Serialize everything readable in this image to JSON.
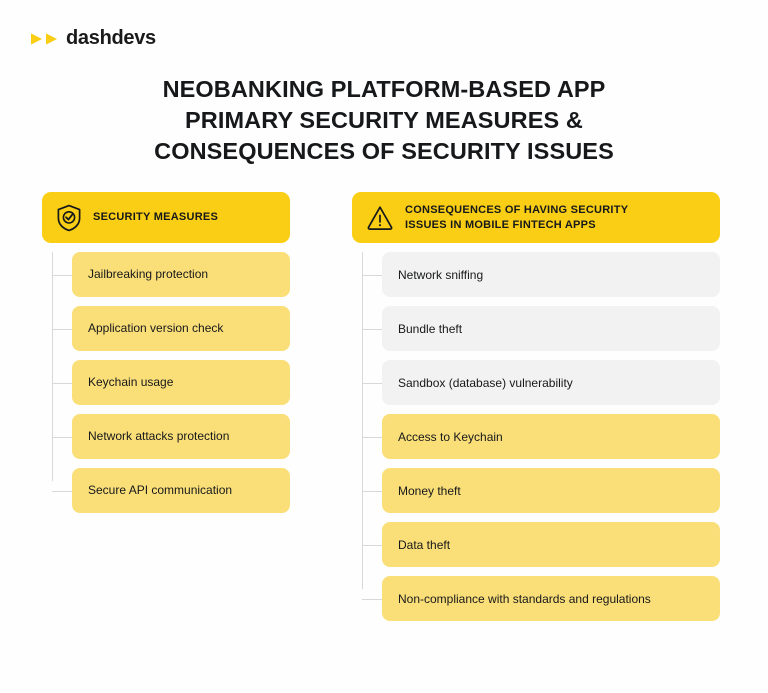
{
  "brand": {
    "name": "dashdevs",
    "mark_icon": "double-triangle-play-icon",
    "accent_color": "#f9ce15"
  },
  "title": {
    "lines": [
      "NEOBANKING PLATFORM-BASED APP",
      "PRIMARY SECURITY MEASURES &",
      "CONSEQUENCES OF SECURITY ISSUES"
    ]
  },
  "colors": {
    "background": "#fefefe",
    "header_yellow": "#f9ce15",
    "item_yellow": "#fadf79",
    "item_gray": "#f2f2f2",
    "text_dark": "#17181a",
    "connector_gray": "#d8d8d8"
  },
  "columns": [
    {
      "id": "security-measures",
      "icon": "shield-check-icon",
      "header": "SECURITY MEASURES",
      "header_lines": [
        "SECURITY MEASURES"
      ],
      "items": [
        {
          "label": "Jailbreaking protection",
          "tone": "yellow"
        },
        {
          "label": "Application version check",
          "tone": "yellow"
        },
        {
          "label": "Keychain usage",
          "tone": "yellow"
        },
        {
          "label": "Network attacks protection",
          "tone": "yellow"
        },
        {
          "label": "Secure API communication",
          "tone": "yellow"
        }
      ]
    },
    {
      "id": "security-consequences",
      "icon": "warning-triangle-icon",
      "header": "CONSEQUENCES OF HAVING SECURITY ISSUES IN MOBILE FINTECH APPS",
      "header_lines": [
        "CONSEQUENCES OF HAVING SECURITY",
        "ISSUES IN MOBILE FINTECH APPS"
      ],
      "items": [
        {
          "label": "Network sniffing",
          "tone": "gray"
        },
        {
          "label": "Bundle theft",
          "tone": "gray"
        },
        {
          "label": "Sandbox (database) vulnerability",
          "tone": "gray"
        },
        {
          "label": "Access to Keychain",
          "tone": "yellow"
        },
        {
          "label": "Money theft",
          "tone": "yellow"
        },
        {
          "label": "Data theft",
          "tone": "yellow"
        },
        {
          "label": "Non-compliance with standards and regulations",
          "tone": "yellow"
        }
      ]
    }
  ]
}
